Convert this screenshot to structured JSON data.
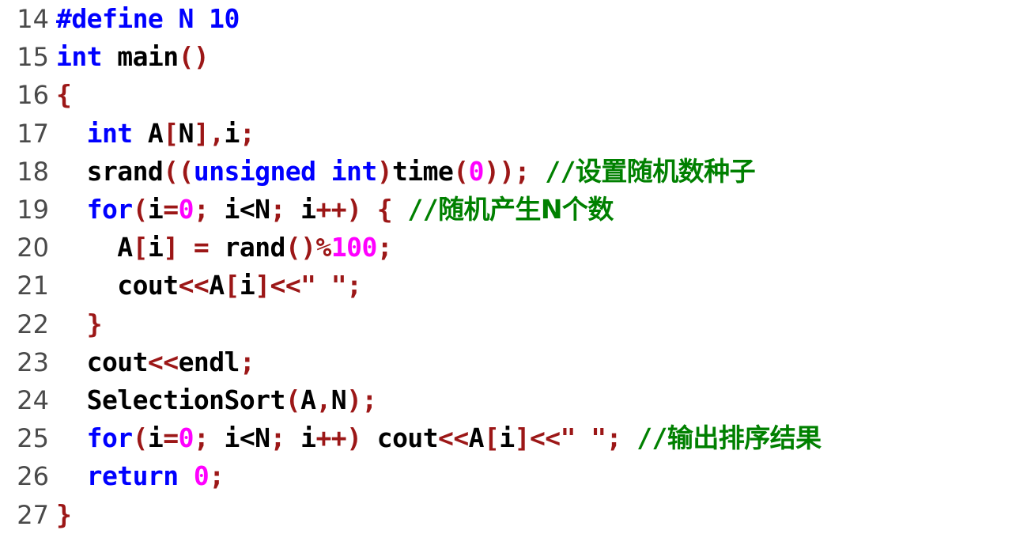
{
  "editor": {
    "background": "#ffffff",
    "gutter_color": "#4a4a4a",
    "language": "C++",
    "first_line_number": 14,
    "last_line_number": 27
  },
  "palette": {
    "keyword": "#0000ff",
    "preprocessor": "#0000ff",
    "identifier": "#000000",
    "punctuation": "#9c1717",
    "number": "#ff00ff",
    "string": "#9c1717",
    "comment": "#008000"
  },
  "lines": [
    {
      "number": "14",
      "text": "#define N 10",
      "tokens": [
        {
          "t": "#define N 10",
          "c": "pre"
        }
      ]
    },
    {
      "number": "15",
      "text": "int main()",
      "tokens": [
        {
          "t": "int",
          "c": "kw"
        },
        {
          "t": " ",
          "c": "plain"
        },
        {
          "t": "main",
          "c": "id"
        },
        {
          "t": "()",
          "c": "punc"
        }
      ]
    },
    {
      "number": "16",
      "text": "{",
      "tokens": [
        {
          "t": "{",
          "c": "punc"
        }
      ]
    },
    {
      "number": "17",
      "text": "  int A[N],i;",
      "tokens": [
        {
          "t": "  ",
          "c": "plain"
        },
        {
          "t": "int",
          "c": "kw"
        },
        {
          "t": " A",
          "c": "id"
        },
        {
          "t": "[",
          "c": "punc"
        },
        {
          "t": "N",
          "c": "id"
        },
        {
          "t": "],",
          "c": "punc"
        },
        {
          "t": "i",
          "c": "id"
        },
        {
          "t": ";",
          "c": "punc"
        }
      ]
    },
    {
      "number": "18",
      "text": "  srand((unsigned int)time(0)); //设置随机数种子",
      "tokens": [
        {
          "t": "  ",
          "c": "plain"
        },
        {
          "t": "srand",
          "c": "id"
        },
        {
          "t": "((",
          "c": "punc"
        },
        {
          "t": "unsigned int",
          "c": "kw"
        },
        {
          "t": ")",
          "c": "punc"
        },
        {
          "t": "time",
          "c": "id"
        },
        {
          "t": "(",
          "c": "punc"
        },
        {
          "t": "0",
          "c": "num"
        },
        {
          "t": "));",
          "c": "punc"
        },
        {
          "t": " ",
          "c": "plain"
        },
        {
          "t": "//",
          "c": "cmt"
        },
        {
          "t": "设置随机数种子",
          "c": "cmt-cjk"
        }
      ]
    },
    {
      "number": "19",
      "text": "  for(i=0; i<N; i++) { //随机产生N个数",
      "tokens": [
        {
          "t": "  ",
          "c": "plain"
        },
        {
          "t": "for",
          "c": "kw"
        },
        {
          "t": "(",
          "c": "punc"
        },
        {
          "t": "i",
          "c": "id"
        },
        {
          "t": "=",
          "c": "punc"
        },
        {
          "t": "0",
          "c": "num"
        },
        {
          "t": ";",
          "c": "punc"
        },
        {
          "t": " i<N",
          "c": "id"
        },
        {
          "t": ";",
          "c": "punc"
        },
        {
          "t": " i",
          "c": "id"
        },
        {
          "t": "++)",
          "c": "punc"
        },
        {
          "t": " ",
          "c": "plain"
        },
        {
          "t": "{",
          "c": "punc"
        },
        {
          "t": " ",
          "c": "plain"
        },
        {
          "t": "//",
          "c": "cmt"
        },
        {
          "t": "随机产生N个数",
          "c": "cmt-cjk"
        }
      ]
    },
    {
      "number": "20",
      "text": "    A[i] = rand()%100;",
      "tokens": [
        {
          "t": "    ",
          "c": "plain"
        },
        {
          "t": "A",
          "c": "id"
        },
        {
          "t": "[",
          "c": "punc"
        },
        {
          "t": "i",
          "c": "id"
        },
        {
          "t": "]",
          "c": "punc"
        },
        {
          "t": " ",
          "c": "plain"
        },
        {
          "t": "=",
          "c": "punc"
        },
        {
          "t": " ",
          "c": "plain"
        },
        {
          "t": "rand",
          "c": "id"
        },
        {
          "t": "()%",
          "c": "punc"
        },
        {
          "t": "100",
          "c": "num"
        },
        {
          "t": ";",
          "c": "punc"
        }
      ]
    },
    {
      "number": "21",
      "text": "    cout<<A[i]<<\" \";",
      "tokens": [
        {
          "t": "    ",
          "c": "plain"
        },
        {
          "t": "cout",
          "c": "id"
        },
        {
          "t": "<<",
          "c": "punc"
        },
        {
          "t": "A",
          "c": "id"
        },
        {
          "t": "[",
          "c": "punc"
        },
        {
          "t": "i",
          "c": "id"
        },
        {
          "t": "]",
          "c": "punc"
        },
        {
          "t": "<<",
          "c": "punc"
        },
        {
          "t": "\" \"",
          "c": "str"
        },
        {
          "t": ";",
          "c": "punc"
        }
      ]
    },
    {
      "number": "22",
      "text": "  }",
      "tokens": [
        {
          "t": "  ",
          "c": "plain"
        },
        {
          "t": "}",
          "c": "punc"
        }
      ]
    },
    {
      "number": "23",
      "text": "  cout<<endl;",
      "tokens": [
        {
          "t": "  ",
          "c": "plain"
        },
        {
          "t": "cout",
          "c": "id"
        },
        {
          "t": "<<",
          "c": "punc"
        },
        {
          "t": "endl",
          "c": "id"
        },
        {
          "t": ";",
          "c": "punc"
        }
      ]
    },
    {
      "number": "24",
      "text": "  SelectionSort(A,N);",
      "tokens": [
        {
          "t": "  ",
          "c": "plain"
        },
        {
          "t": "SelectionSort",
          "c": "id"
        },
        {
          "t": "(",
          "c": "punc"
        },
        {
          "t": "A",
          "c": "id"
        },
        {
          "t": ",",
          "c": "punc"
        },
        {
          "t": "N",
          "c": "id"
        },
        {
          "t": ");",
          "c": "punc"
        }
      ]
    },
    {
      "number": "25",
      "text": "  for(i=0; i<N; i++) cout<<A[i]<<\" \"; //输出排序结果",
      "tokens": [
        {
          "t": "  ",
          "c": "plain"
        },
        {
          "t": "for",
          "c": "kw"
        },
        {
          "t": "(",
          "c": "punc"
        },
        {
          "t": "i",
          "c": "id"
        },
        {
          "t": "=",
          "c": "punc"
        },
        {
          "t": "0",
          "c": "num"
        },
        {
          "t": ";",
          "c": "punc"
        },
        {
          "t": " i<N",
          "c": "id"
        },
        {
          "t": ";",
          "c": "punc"
        },
        {
          "t": " i",
          "c": "id"
        },
        {
          "t": "++)",
          "c": "punc"
        },
        {
          "t": " cout",
          "c": "id"
        },
        {
          "t": "<<",
          "c": "punc"
        },
        {
          "t": "A",
          "c": "id"
        },
        {
          "t": "[",
          "c": "punc"
        },
        {
          "t": "i",
          "c": "id"
        },
        {
          "t": "]",
          "c": "punc"
        },
        {
          "t": "<<",
          "c": "punc"
        },
        {
          "t": "\" \"",
          "c": "str"
        },
        {
          "t": ";",
          "c": "punc"
        },
        {
          "t": " ",
          "c": "plain"
        },
        {
          "t": "//",
          "c": "cmt"
        },
        {
          "t": "输出排序结果",
          "c": "cmt-cjk"
        }
      ]
    },
    {
      "number": "26",
      "text": "  return 0;",
      "tokens": [
        {
          "t": "  ",
          "c": "plain"
        },
        {
          "t": "return",
          "c": "kw"
        },
        {
          "t": " ",
          "c": "plain"
        },
        {
          "t": "0",
          "c": "num"
        },
        {
          "t": ";",
          "c": "punc"
        }
      ]
    },
    {
      "number": "27",
      "text": "}",
      "tokens": [
        {
          "t": "}",
          "c": "punc"
        }
      ]
    }
  ]
}
